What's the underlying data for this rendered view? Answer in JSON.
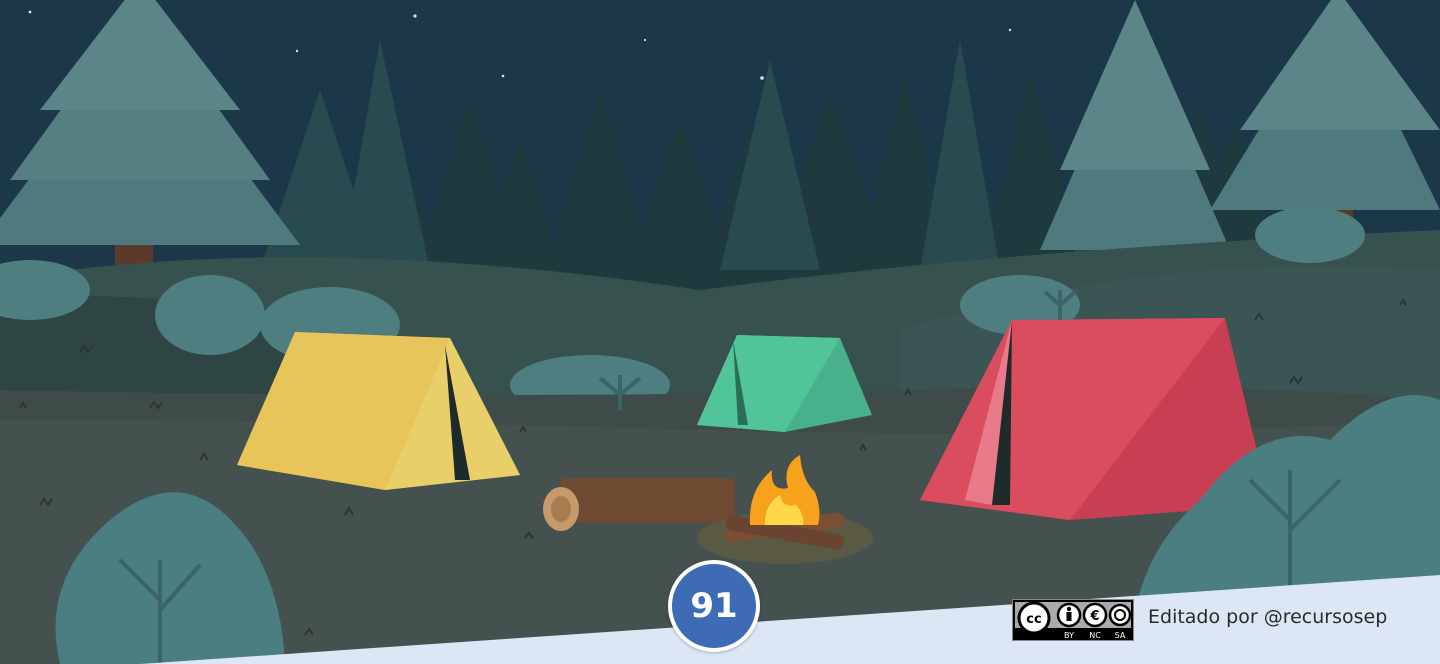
{
  "page_number": "91",
  "license": {
    "badge_name": "cc-by-nc-sa-license-badge",
    "main_glyphs": "cc",
    "labels": [
      "BY",
      "NC",
      "SA"
    ]
  },
  "credit_text": "Editado por @recursosep",
  "colors": {
    "sky": "#1c3848",
    "far_trees": "#1e3a3c",
    "mid_trees": "#3f6a70",
    "ground": "#3f4b49",
    "yellow_tent": "#e8c55a",
    "green_tent": "#52c49a",
    "red_tent": "#d94d5e",
    "fire": "#f6a21c",
    "footer_band": "#dce6f5",
    "badge": "#3d6cb5"
  },
  "icons": [
    "star-icon",
    "campfire-icon",
    "tent-icon",
    "pine-tree-icon",
    "log-icon",
    "bush-icon"
  ]
}
